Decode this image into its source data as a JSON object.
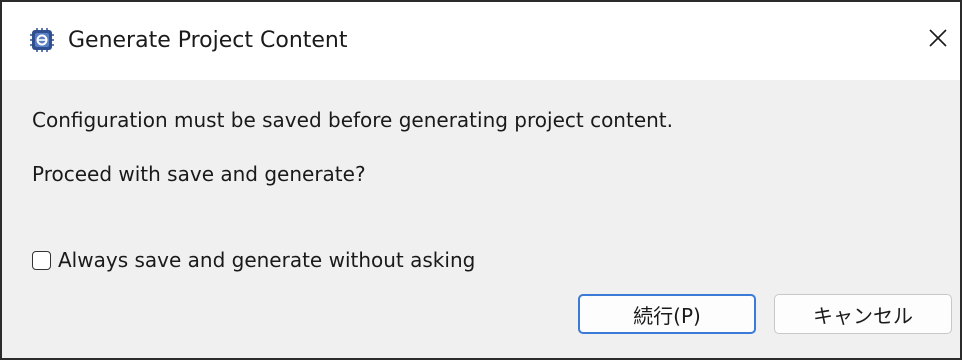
{
  "dialog": {
    "title": "Generate Project Content",
    "app_icon": "eclipse-chip-icon",
    "close_icon": "close-icon",
    "message_line1": "Configuration must be saved before generating project content.",
    "message_line2": "Proceed with save and generate?",
    "checkbox": {
      "label": "Always save and generate without asking",
      "checked": false
    },
    "buttons": {
      "proceed_label": "続行(P)",
      "cancel_label": "キャンセル"
    }
  },
  "colors": {
    "accent": "#3b7ad6",
    "background": "#f0f0f0",
    "titlebar": "#ffffff"
  }
}
